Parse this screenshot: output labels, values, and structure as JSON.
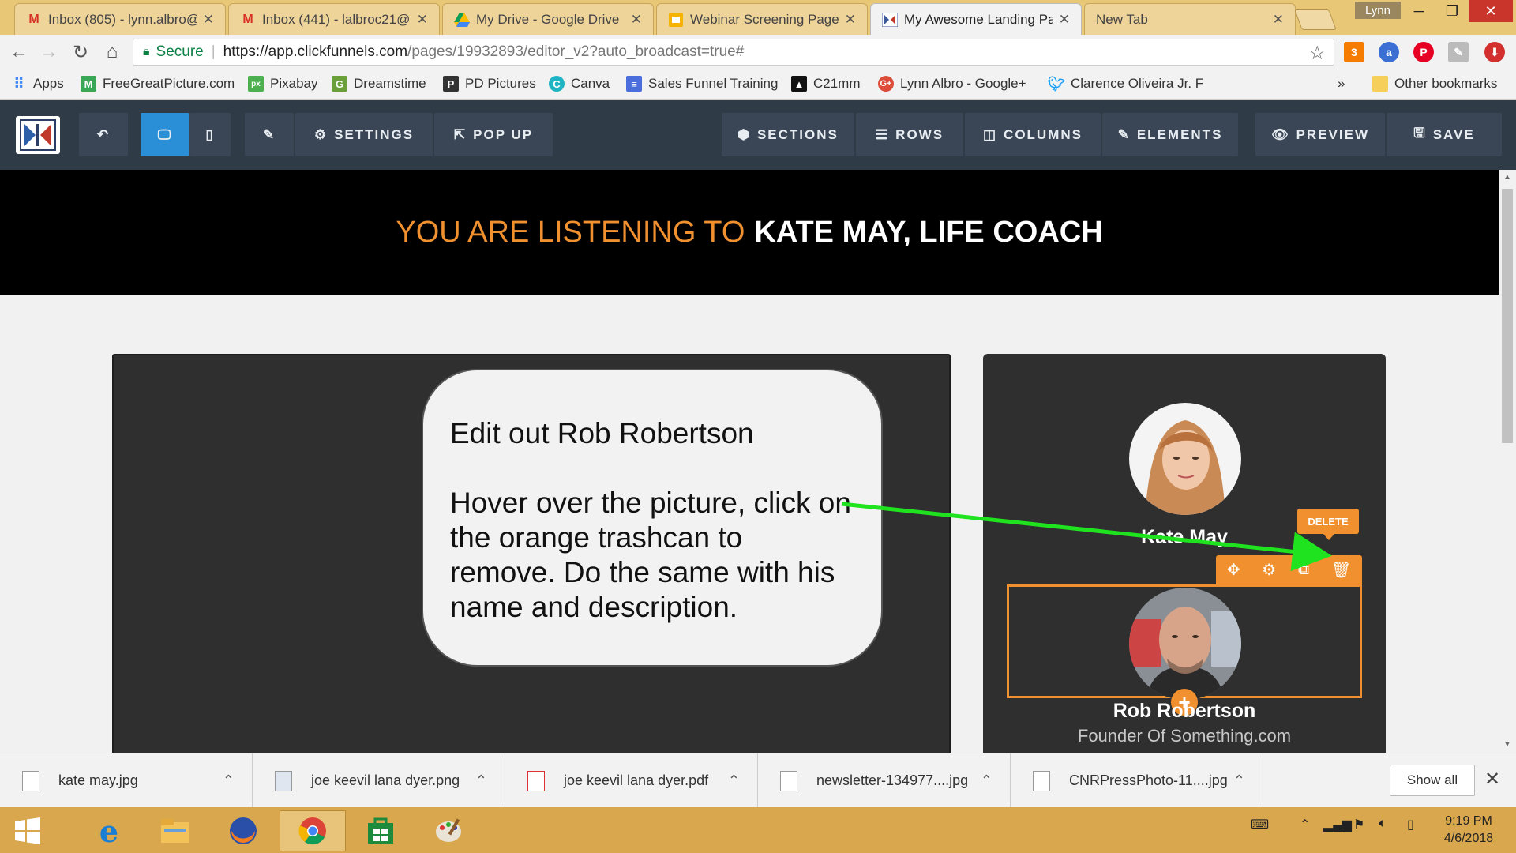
{
  "browser": {
    "tabs": [
      {
        "title": "Inbox (805) - lynn.albro@",
        "icon": "gmail-icon",
        "active": false
      },
      {
        "title": "Inbox (441) - lalbroc21@",
        "icon": "gmail-icon",
        "active": false
      },
      {
        "title": "My Drive - Google Drive",
        "icon": "drive-icon",
        "active": false
      },
      {
        "title": "Webinar Screening Page",
        "icon": "slides-icon",
        "active": false
      },
      {
        "title": "My Awesome Landing Pa",
        "icon": "clickfunnels-icon",
        "active": true
      },
      {
        "title": "New Tab",
        "icon": "",
        "active": false
      }
    ],
    "user": "Lynn",
    "omnibox": {
      "secure_label": "Secure",
      "url_host": "https://app.clickfunnels.com",
      "url_path": "/pages/19932893/editor_v2?auto_broadcast=true#"
    },
    "bookmarks": [
      {
        "label": "Apps",
        "icon": "apps-grid-icon",
        "color": "#4285f4"
      },
      {
        "label": "FreeGreatPicture.com",
        "icon": "m-logo-icon",
        "color": "#3aa757"
      },
      {
        "label": "Pixabay",
        "icon": "pixabay-icon",
        "color": "#4caf50"
      },
      {
        "label": "Dreamstime",
        "icon": "dreamstime-icon",
        "color": "#6a9f3a"
      },
      {
        "label": "PD Pictures",
        "icon": "pd-pictures-icon",
        "color": "#333333"
      },
      {
        "label": "Canva",
        "icon": "canva-icon",
        "color": "#1fb4c4"
      },
      {
        "label": "Sales Funnel Training",
        "icon": "document-icon",
        "color": "#4a6fdc"
      },
      {
        "label": "C21mm",
        "icon": "c21-icon",
        "color": "#111111"
      },
      {
        "label": "Lynn Albro - Google+",
        "icon": "google-plus-icon",
        "color": "#dd4b39"
      },
      {
        "label": "Clarence Oliveira Jr. F",
        "icon": "twitter-icon",
        "color": "#1da1f2"
      }
    ],
    "bookmarks_overflow": "»",
    "other_bookmarks": "Other bookmarks"
  },
  "editor": {
    "toolbar": {
      "settings": "SETTINGS",
      "popup": "POP UP",
      "sections": "SECTIONS",
      "rows": "ROWS",
      "columns": "COLUMNS",
      "elements": "ELEMENTS",
      "preview": "PREVIEW",
      "save": "SAVE"
    },
    "page": {
      "listen_prefix": "YOU ARE LISTENING TO",
      "listen_name": "KATE MAY, LIFE COACH",
      "person1_name": "Kate May",
      "person2_name": "Rob Robertson",
      "person2_desc": "Founder Of Something.com",
      "delete_tooltip": "DELETE"
    },
    "accent_color": "#f0902f"
  },
  "callout": {
    "line1": "Edit out Rob Robertson",
    "line2": "Hover over the picture, click on the orange trashcan to remove. Do the same with his name and description."
  },
  "downloads": {
    "items": [
      {
        "name": "kate may.jpg",
        "icon": "file-icon"
      },
      {
        "name": "joe keevil lana dyer.png",
        "icon": "image-file-icon"
      },
      {
        "name": "joe keevil lana dyer.pdf",
        "icon": "pdf-file-icon"
      },
      {
        "name": "newsletter-134977....jpg",
        "icon": "file-icon"
      },
      {
        "name": "CNRPressPhoto-11....jpg",
        "icon": "file-icon"
      }
    ],
    "show_all": "Show all"
  },
  "taskbar": {
    "time": "9:19 PM",
    "date": "4/6/2018"
  }
}
